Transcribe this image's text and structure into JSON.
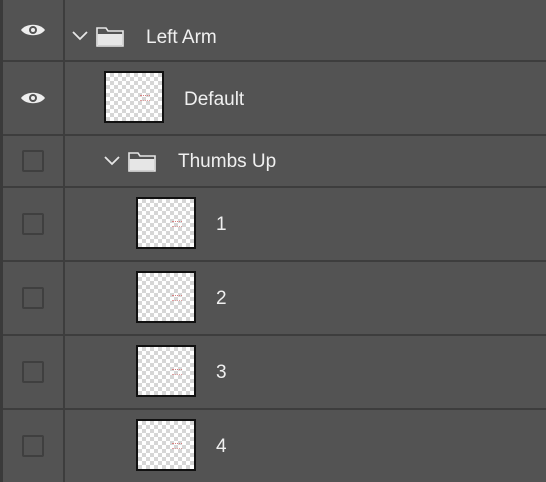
{
  "layers": [
    {
      "type": "group",
      "label": "Left Arm",
      "visible": true,
      "expanded": true,
      "icon": "folder-icon"
    },
    {
      "type": "layer",
      "label": "Default",
      "visible": true
    },
    {
      "type": "group",
      "label": "Thumbs Up",
      "visible": false,
      "expanded": true,
      "icon": "folder-icon"
    },
    {
      "type": "layer",
      "label": "1",
      "visible": false
    },
    {
      "type": "layer",
      "label": "2",
      "visible": false
    },
    {
      "type": "layer",
      "label": "3",
      "visible": false
    },
    {
      "type": "layer",
      "label": "4",
      "visible": false
    }
  ],
  "colors": {
    "panel_bg": "#535353",
    "divider": "#3d3d3d",
    "text": "#f0f0f0"
  }
}
